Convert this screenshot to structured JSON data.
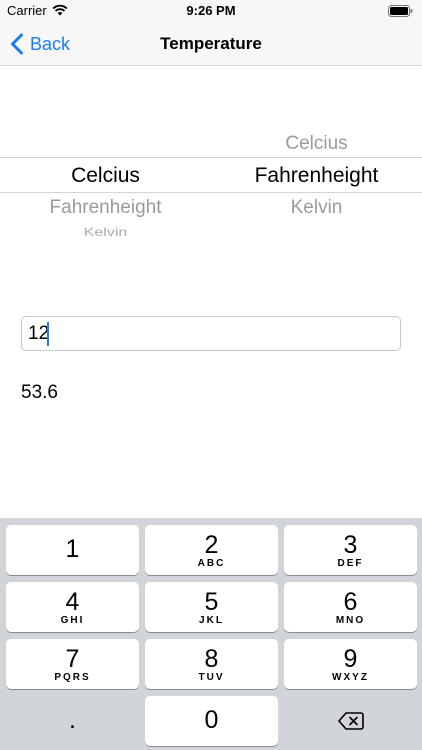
{
  "status_bar": {
    "carrier": "Carrier",
    "time": "9:26 PM"
  },
  "nav": {
    "back_label": "Back",
    "title": "Temperature"
  },
  "picker_from": {
    "above": "",
    "selected": "Celcius",
    "below": "Fahrenheight",
    "below2": "Kelvin"
  },
  "picker_to": {
    "above": "Celcius",
    "selected": "Fahrenheight",
    "below": "Kelvin",
    "below2": ""
  },
  "input": {
    "value": "12",
    "placeholder": ""
  },
  "result": "53.6",
  "keypad": {
    "keys": [
      {
        "digit": "1",
        "letters": ""
      },
      {
        "digit": "2",
        "letters": "ABC"
      },
      {
        "digit": "3",
        "letters": "DEF"
      },
      {
        "digit": "4",
        "letters": "GHI"
      },
      {
        "digit": "5",
        "letters": "JKL"
      },
      {
        "digit": "6",
        "letters": "MNO"
      },
      {
        "digit": "7",
        "letters": "PQRS"
      },
      {
        "digit": "8",
        "letters": "TUV"
      },
      {
        "digit": "9",
        "letters": "WXYZ"
      }
    ],
    "decimal": ".",
    "zero": "0",
    "delete_icon": "backspace-icon"
  },
  "colors": {
    "accent": "#1a7cf5",
    "keypad_bg": "#d1d4d9",
    "bar_bg": "#f7f7f7"
  }
}
